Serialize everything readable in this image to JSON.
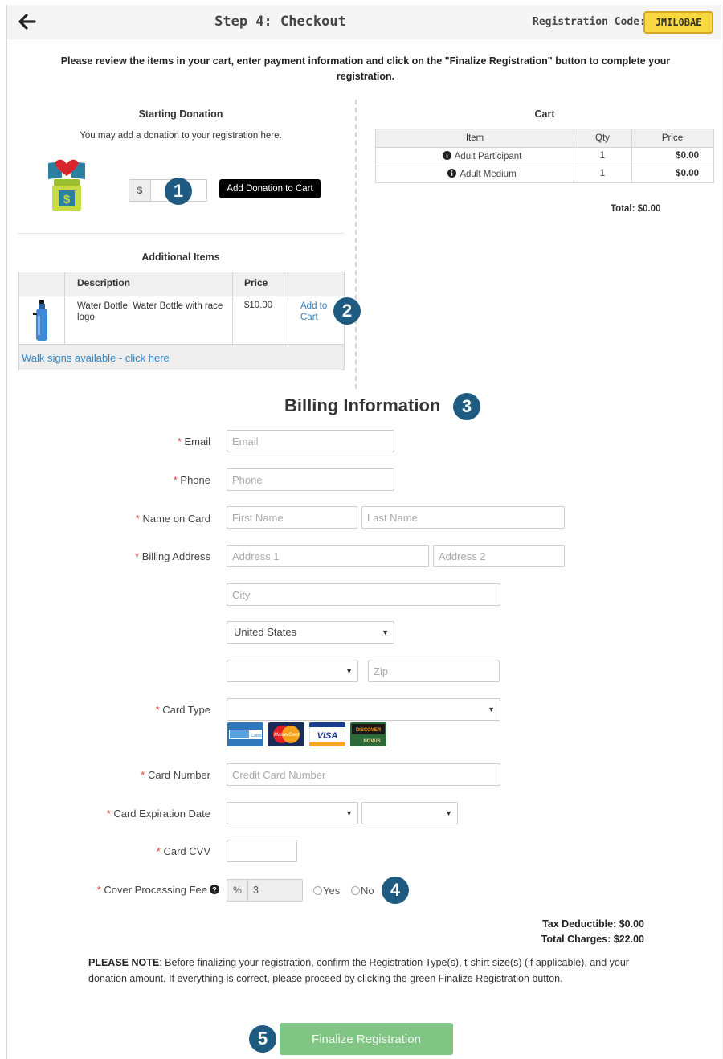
{
  "header": {
    "title": "Step 4: Checkout",
    "registration_label": "Registration Code:",
    "registration_code": "JMIL0BAE"
  },
  "instructions": "Please review the items in your cart, enter payment information and click on the \"Finalize Registration\" button to complete your registration.",
  "donation": {
    "title": "Starting Donation",
    "subtitle": "You may add a donation to your registration here.",
    "currency_symbol": "$",
    "amount": "",
    "button_label": "Add Donation to Cart"
  },
  "additional_items": {
    "title": "Additional Items",
    "columns": [
      "Description",
      "Price"
    ],
    "items": [
      {
        "description": "Water Bottle: Water Bottle with race logo",
        "price": "$10.00",
        "action": "Add to Cart"
      }
    ],
    "footer_link": "Walk signs available - click here"
  },
  "cart": {
    "title": "Cart",
    "columns": [
      "Item",
      "Qty",
      "Price"
    ],
    "rows": [
      {
        "item": "Adult Participant",
        "qty": "1",
        "price": "$0.00"
      },
      {
        "item": "Adult Medium",
        "qty": "1",
        "price": "$0.00"
      }
    ],
    "total": "Total: $0.00"
  },
  "billing": {
    "title": "Billing Information",
    "required_mark": "*",
    "labels": {
      "email": "Email",
      "phone": "Phone",
      "name_on_card": "Name on Card",
      "billing_address": "Billing Address",
      "card_type": "Card Type",
      "card_number": "Card Number",
      "card_expiration": "Card Expiration Date",
      "card_cvv": "Card CVV",
      "cover_fee": "Cover Processing Fee"
    },
    "placeholders": {
      "email": "Email",
      "phone": "Phone",
      "first_name": "First Name",
      "last_name": "Last Name",
      "address1": "Address 1",
      "address2": "Address 2",
      "city": "City",
      "zip": "Zip",
      "card_number": "Credit Card Number"
    },
    "country": "United States",
    "state": "",
    "card_type": "",
    "exp_month": "",
    "exp_year": "",
    "card_logos": [
      "American Express",
      "MasterCard",
      "VISA",
      "DISCOVER NOVUS"
    ],
    "fee_symbol": "%",
    "fee_value": "3",
    "fee_yes": "Yes",
    "fee_no": "No"
  },
  "summary": {
    "tax_deductible": "Tax Deductible: $0.00",
    "total_charges": "Total Charges: $22.00"
  },
  "note": {
    "prefix": "PLEASE NOTE",
    "text": ": Before finalizing your registration, confirm the Registration Type(s), t-shirt size(s) (if applicable), and your donation amount. If everything is correct, please proceed by clicking the green Finalize Registration button."
  },
  "finalize_label": "Finalize Registration",
  "badges": [
    "1",
    "2",
    "3",
    "4",
    "5"
  ],
  "colors": {
    "code_badge": "#f7d93f",
    "link": "#337ab7",
    "finalize": "#80c584",
    "step_badge": "#1f5b80",
    "required": "#e0433a"
  }
}
